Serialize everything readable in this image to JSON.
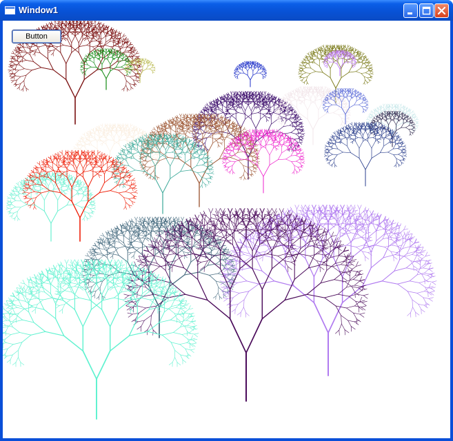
{
  "window": {
    "title": "Window1"
  },
  "controls": {
    "button_label": "Button"
  },
  "colors": {
    "titlebar": "#0852d6",
    "frame": "#0a4fd8",
    "client_background": "#ffffff"
  },
  "trees": [
    {
      "color": "#7a0f0f"
    },
    {
      "color": "#128a12"
    },
    {
      "color": "#b5b544"
    },
    {
      "color": "#1c2ec8"
    },
    {
      "color": "#7d7d1e"
    },
    {
      "color": "#b86ef0"
    },
    {
      "color": "#faeee0"
    },
    {
      "color": "#3a0a6a"
    },
    {
      "color": "#f2e6ea"
    },
    {
      "color": "#5a6ad8"
    },
    {
      "color": "#c8e8ea"
    },
    {
      "color": "#2a2248"
    },
    {
      "color": "#a05c3a"
    },
    {
      "color": "#ee22cc"
    },
    {
      "color": "#3aa898"
    },
    {
      "color": "#2a3e8c"
    },
    {
      "color": "#68f0d0"
    },
    {
      "color": "#ee1f08"
    },
    {
      "color": "#4a6e82"
    },
    {
      "color": "#b07af0"
    },
    {
      "color": "#4a0a5a"
    },
    {
      "color": "#60f2d0"
    }
  ]
}
